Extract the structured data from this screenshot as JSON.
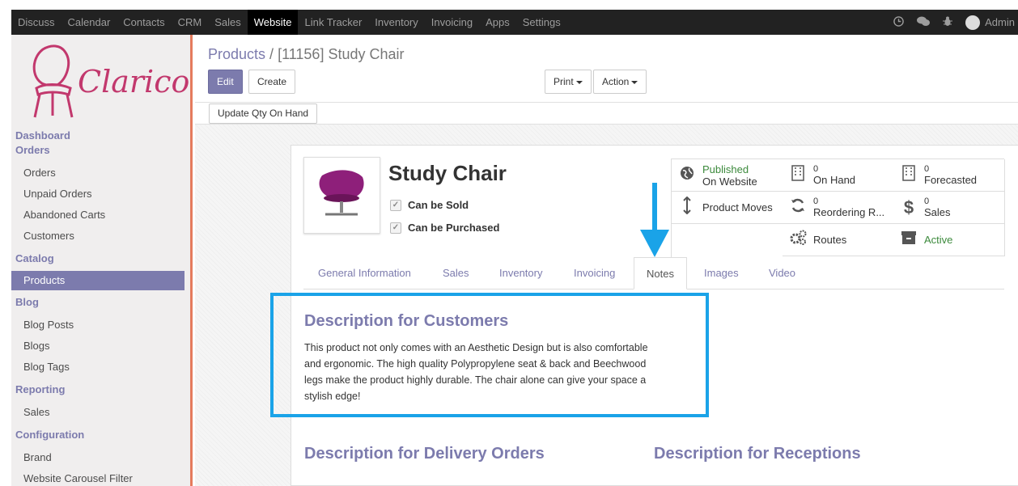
{
  "topbar": {
    "menu": [
      "Discuss",
      "Calendar",
      "Contacts",
      "CRM",
      "Sales",
      "Website",
      "Link Tracker",
      "Inventory",
      "Invoicing",
      "Apps",
      "Settings"
    ],
    "active": "Website",
    "user": "Admin"
  },
  "logo": {
    "text": "Clarico"
  },
  "sidebar": {
    "sections": [
      {
        "header": "Dashboard",
        "items": []
      },
      {
        "header": "Orders",
        "items": [
          "Orders",
          "Unpaid Orders",
          "Abandoned Carts",
          "Customers"
        ]
      },
      {
        "header": "Catalog",
        "items": [
          "Products"
        ]
      },
      {
        "header": "Blog",
        "items": [
          "Blog Posts",
          "Blogs",
          "Blog Tags"
        ]
      },
      {
        "header": "Reporting",
        "items": [
          "Sales"
        ]
      },
      {
        "header": "Configuration",
        "items": [
          "Brand",
          "Website Carousel Filter"
        ]
      }
    ],
    "selected": "Products"
  },
  "control": {
    "breadcrumb_link": "Products",
    "breadcrumb_sep": " / ",
    "breadcrumb_current": "[11156] Study Chair",
    "edit": "Edit",
    "create": "Create",
    "print": "Print",
    "action": "Action",
    "update_qty": "Update Qty On Hand"
  },
  "product": {
    "name": "Study Chair",
    "can_be_sold": "Can be Sold",
    "can_be_purchased": "Can be Purchased"
  },
  "smart_buttons": {
    "published_line1": "Published",
    "published_line2": "On Website",
    "on_hand_num": "0",
    "on_hand_label": "On Hand",
    "forecasted_num": "0",
    "forecasted_label": "Forecasted",
    "moves_label": "Product Moves",
    "reorder_num": "0",
    "reorder_label": "Reordering R...",
    "sales_num": "0",
    "sales_label": "Sales",
    "routes_label": "Routes",
    "active_label": "Active"
  },
  "tabs": [
    "General Information",
    "Sales",
    "Inventory",
    "Invoicing",
    "Notes",
    "Images",
    "Video"
  ],
  "active_tab": "Notes",
  "notes": {
    "customers_heading": "Description for Customers",
    "customers_text": "This product not only comes with an Aesthetic Design but is also comfortable and ergonomic. The high quality Polypropylene seat & back and Beechwood legs make the product highly durable. The chair alone can give your space a stylish edge!",
    "delivery_heading": "Description for Delivery Orders",
    "receptions_heading": "Description for Receptions"
  },
  "colors": {
    "accent": "#7c7bad",
    "highlight": "#1aa3e8",
    "logo": "#c2386d"
  }
}
